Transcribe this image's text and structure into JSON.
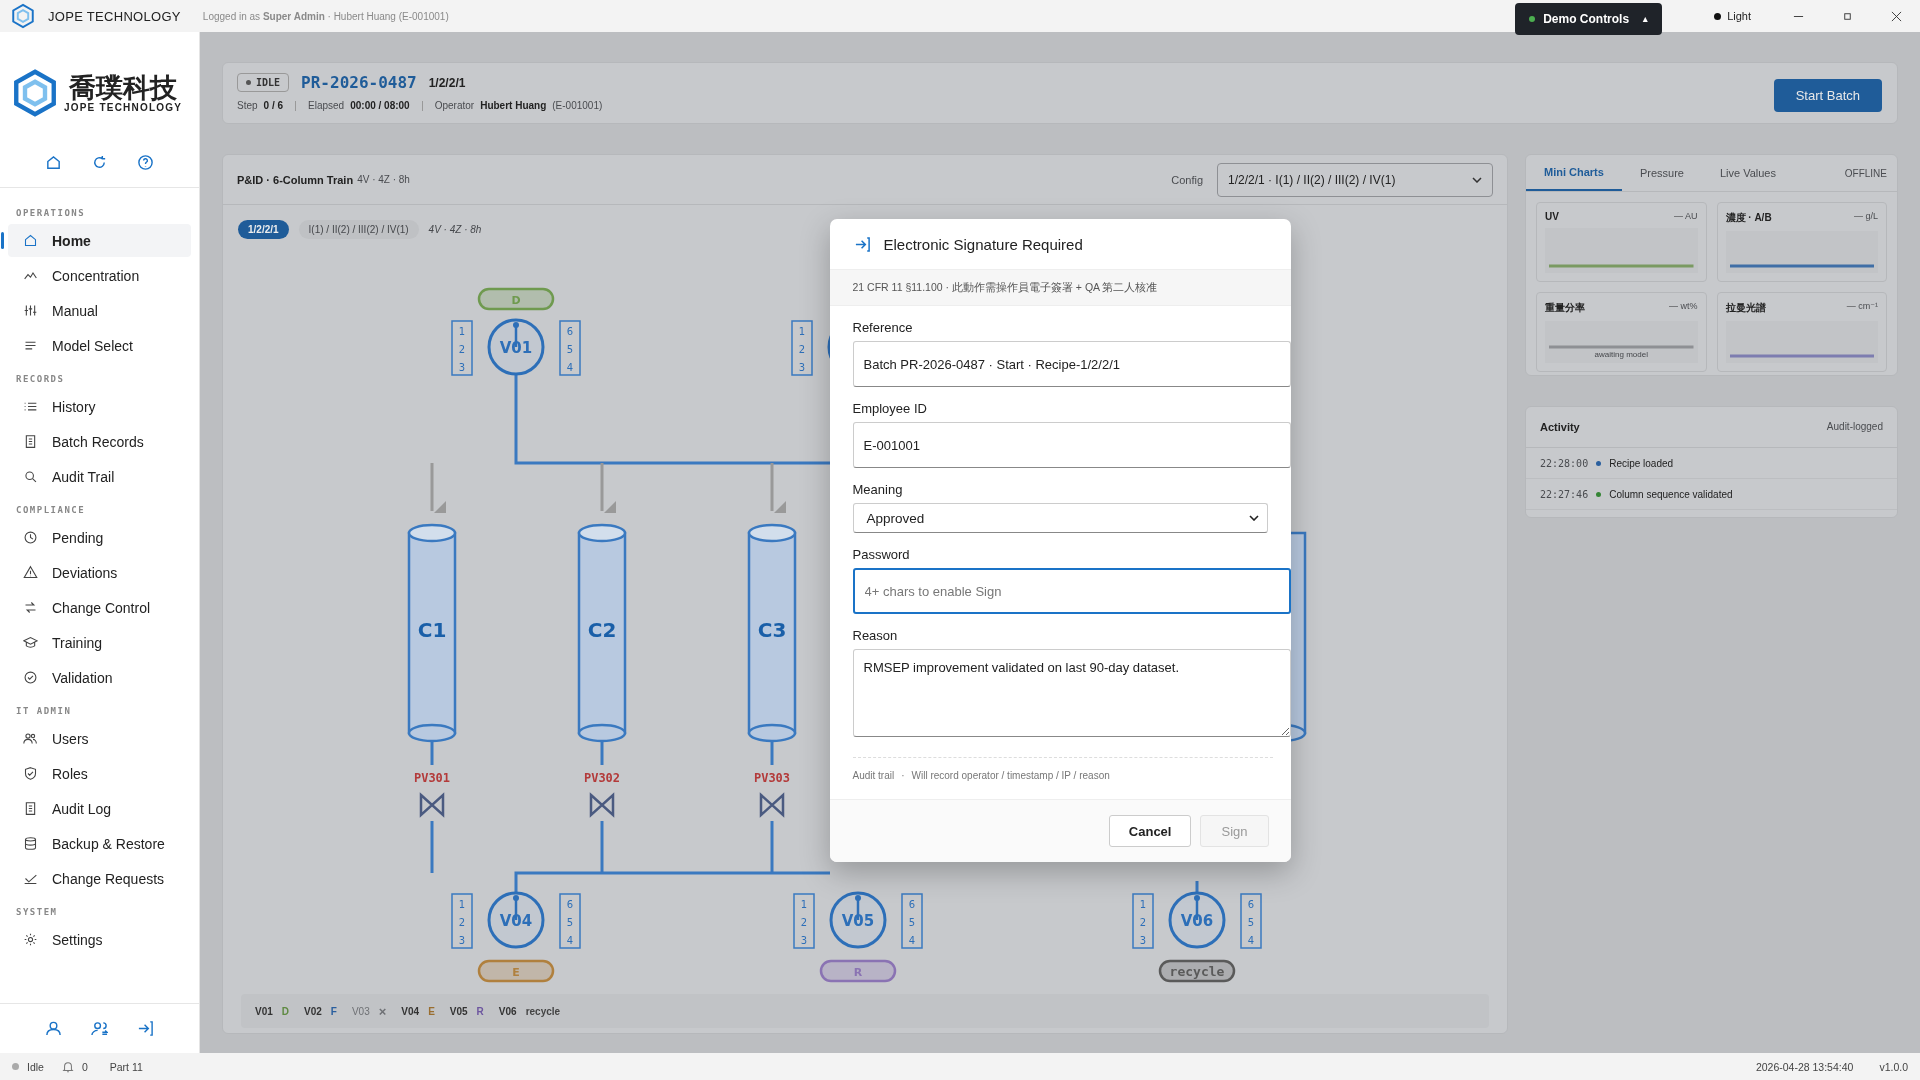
{
  "app": {
    "name": "JOPE TECHNOLOGY",
    "login": "Logged in as **Super Admin** · Hubert Huang (E-001001)",
    "demo_controls": "Demo Controls",
    "demo_caret": "▴",
    "theme": "Light"
  },
  "sidebar": {
    "logo_cn": "喬璞科技",
    "logo_en": "JOPE TECHNOLOGY",
    "sections": [
      {
        "title": "OPERATIONS",
        "items": [
          {
            "label": "Home",
            "selected": true
          },
          {
            "label": "Concentration",
            "selected": false
          },
          {
            "label": "Manual",
            "selected": false
          },
          {
            "label": "Model Select",
            "selected": false
          }
        ]
      },
      {
        "title": "RECORDS",
        "items": [
          {
            "label": "History",
            "selected": false
          },
          {
            "label": "Batch Records",
            "selected": false
          },
          {
            "label": "Audit Trail",
            "selected": false
          }
        ]
      },
      {
        "title": "COMPLIANCE",
        "items": [
          {
            "label": "Pending",
            "selected": false
          },
          {
            "label": "Deviations",
            "selected": false
          },
          {
            "label": "Change Control",
            "selected": false
          },
          {
            "label": "Training",
            "selected": false
          },
          {
            "label": "Validation",
            "selected": false
          }
        ]
      },
      {
        "title": "IT ADMIN",
        "items": [
          {
            "label": "Users",
            "selected": false
          },
          {
            "label": "Roles",
            "selected": false
          },
          {
            "label": "Audit Log",
            "selected": false
          },
          {
            "label": "Backup & Restore",
            "selected": false
          },
          {
            "label": "Change Requests",
            "selected": false
          }
        ]
      },
      {
        "title": "SYSTEM",
        "items": [
          {
            "label": "Settings",
            "selected": false
          }
        ]
      }
    ]
  },
  "batch": {
    "state": "IDLE",
    "id": "PR-2026-0487",
    "recipe": "1/2/2/1",
    "step_label": "Step",
    "step": "0 / 6",
    "elapsed_label": "Elapsed",
    "elapsed": "00:00 / 08:00",
    "operator_label": "Operator",
    "operator": "Hubert Huang",
    "operator_id": "(E-001001)",
    "start_button": "Start Batch"
  },
  "pid": {
    "title": "P&ID · 6-Column Train",
    "subtitle": "4V · 4Z · 8h",
    "config_label": "Config",
    "config_value": "1/2/2/1 · I(1) / II(2) / III(2) / IV(1)",
    "chips": [
      {
        "label": "1/2/2/1",
        "selected": true
      },
      {
        "label": "I(1) / II(2) / III(2) / IV(1)",
        "selected": false
      }
    ],
    "chip_note": "4V · 4Z · 8h",
    "valves": [
      {
        "label": "V01",
        "left_ports": [
          "1",
          "2",
          "3"
        ],
        "right_ports": [
          "6",
          "5",
          "4"
        ],
        "port": "D",
        "color": "#6f9a4f"
      },
      {
        "left_ports": [
          "1",
          "2",
          "3"
        ]
      },
      {
        "label": "V04",
        "left_ports": [
          "1",
          "2",
          "3"
        ],
        "right_ports": [
          "6",
          "5",
          "4"
        ],
        "port": "E",
        "color": "#b0803e"
      },
      {
        "label": "V05",
        "left_ports": [
          "1",
          "2",
          "3"
        ],
        "right_ports": [
          "6",
          "5",
          "4"
        ],
        "port": "R",
        "color": "#8a73b3"
      },
      {
        "label": "V06",
        "left_ports": [
          "1",
          "2",
          "3"
        ],
        "right_ports": [
          "6",
          "5",
          "4"
        ],
        "port": "recycle",
        "color": "#5a5a5a"
      }
    ],
    "columns": [
      {
        "label": "C1",
        "valve": "PV301"
      },
      {
        "label": "C2",
        "valve": "PV302"
      },
      {
        "label": "C3",
        "valve": "PV303"
      }
    ],
    "legend": [
      {
        "valve": "V01",
        "port": "D",
        "color": "#5f8a42",
        "disabled": false
      },
      {
        "valve": "V02",
        "port": "F",
        "color": "#2a5f9e",
        "disabled": false
      },
      {
        "valve": "V03",
        "port": "×",
        "color": "#6e7074",
        "disabled": true
      },
      {
        "valve": "V04",
        "port": "E",
        "color": "#9a6e30",
        "disabled": false
      },
      {
        "valve": "V05",
        "port": "R",
        "color": "#6e57a0",
        "disabled": false
      },
      {
        "valve": "V06",
        "port": "recycle",
        "color": "#444444",
        "disabled": false
      }
    ]
  },
  "side_panel": {
    "tabs": [
      {
        "label": "Mini Charts",
        "selected": true
      },
      {
        "label": "Pressure",
        "selected": false
      },
      {
        "label": "Live Values",
        "selected": false
      }
    ],
    "connection": "OFFLINE",
    "charts": [
      {
        "title": "UV",
        "unit": "— AU",
        "color": "#7a9a62"
      },
      {
        "title": "濃度 · A/B",
        "unit": "— g/L",
        "color": "#3f6ea6"
      },
      {
        "title": "重量分率",
        "unit": "— wt%",
        "note": "awaiting model",
        "color": "#8e9094"
      },
      {
        "title": "拉曼光譜",
        "unit": "— cm⁻¹",
        "color": "#7d7db0"
      }
    ],
    "activity_title": "Activity",
    "activity_note": "Audit-logged",
    "activity": [
      {
        "time": "22:28:00",
        "text": "Recipe loaded",
        "color": "#2a5f9e"
      },
      {
        "time": "22:27:46",
        "text": "Column sequence validated",
        "color": "#358535"
      }
    ]
  },
  "dialog": {
    "title": "Electronic Signature Required",
    "subtitle": "21 CFR 11 §11.100 · 此動作需操作員電子簽署 + QA 第二人核准",
    "fields": [
      {
        "kind": "text",
        "label": "Reference",
        "value": "Batch PR-2026-0487 · Start · Recipe-1/2/2/1",
        "focused": false
      },
      {
        "kind": "text",
        "label": "Employee ID",
        "value": "E-001001",
        "focused": false
      },
      {
        "kind": "select",
        "label": "Meaning",
        "value": "Approved",
        "focused": false
      },
      {
        "kind": "password",
        "label": "Password",
        "placeholder": "4+ chars to enable Sign",
        "focused": true
      },
      {
        "kind": "textarea",
        "label": "Reason",
        "value": "RMSEP improvement validated on last 90-day dataset.",
        "focused": false
      }
    ],
    "audit_label": "Audit trail",
    "audit_sep": "·",
    "audit_text": "Will record operator / timestamp / IP / reason",
    "cancel": "Cancel",
    "sign": "Sign",
    "sign_disabled": true
  },
  "status_bar": {
    "state": "Idle",
    "alerts": "0",
    "mode": "Part 11",
    "datetime": "2026-04-28 13:54:40",
    "version": "v1.0.0"
  }
}
